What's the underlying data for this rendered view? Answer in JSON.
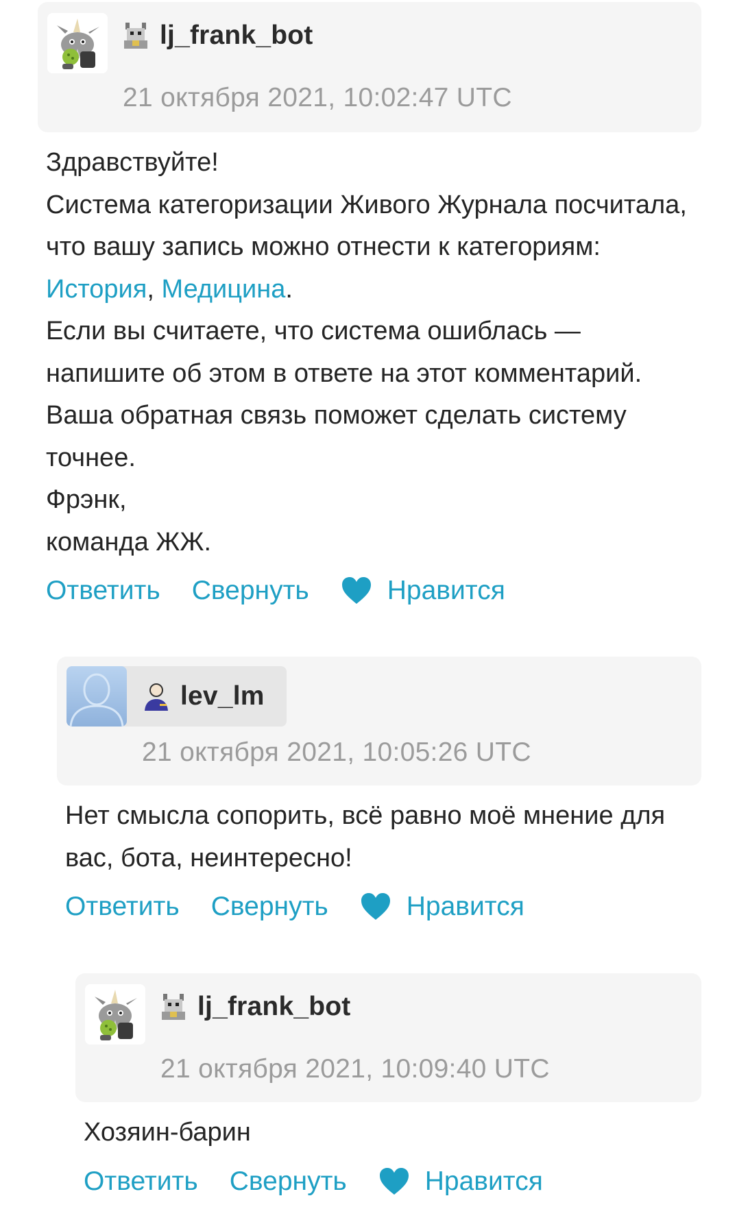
{
  "accent_color": "#1e9fc4",
  "comments": [
    {
      "username": "lj_frank_bot",
      "date": "21 октября 2021, 10:02:47 UTC",
      "body": {
        "l1": "Здравствуйте!",
        "l2": "Система категоризации Живого Журнала посчитала, что вашу запись можно отнести к категориям: ",
        "cat1": "История",
        "sep": ", ",
        "cat2": "Медицина",
        "end": ".",
        "l3": "Если вы считаете, что система ошиблась — напишите об этом в ответе на этот комментарий. Ваша обратная связь поможет сделать систему точнее.",
        "l4": "Фрэнк,",
        "l5": "команда ЖЖ."
      },
      "actions": {
        "reply": "Ответить",
        "collapse": "Свернуть",
        "like": "Нравится"
      }
    },
    {
      "username": "lev_lm",
      "date": "21 октября 2021, 10:05:26 UTC",
      "body": "Нет смысла сопорить, всё равно моё мнение для вас, бота, неинтересно!",
      "actions": {
        "reply": "Ответить",
        "collapse": "Свернуть",
        "like": "Нравится"
      }
    },
    {
      "username": "lj_frank_bot",
      "date": "21 октября 2021, 10:09:40 UTC",
      "body": "Хозяин-барин",
      "actions": {
        "reply": "Ответить",
        "collapse": "Свернуть",
        "like": "Нравится"
      }
    }
  ],
  "icons": {
    "bot_avatar": "frank-goat-avatar",
    "bot_user_icon": "goat-user-icon",
    "lev_avatar": "default-userpic",
    "lev_user_icon": "person-user-icon",
    "like_icon": "heart-icon"
  }
}
